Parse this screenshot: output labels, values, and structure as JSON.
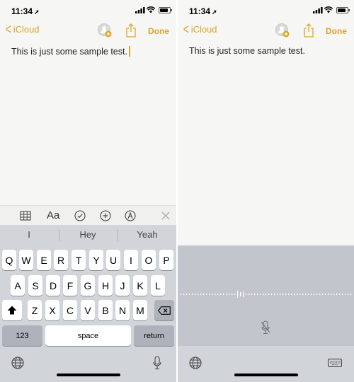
{
  "left": {
    "status": {
      "time": "11:34",
      "location_arrow": "➚"
    },
    "nav": {
      "back_label": "iCloud",
      "done_label": "Done"
    },
    "note_text": "This is just some sample test.",
    "format_toolbar": {
      "text_style": "Aa",
      "icons": [
        "table-icon",
        "checklist-icon",
        "plus-circle-icon",
        "markup-icon",
        "close-icon"
      ]
    },
    "predictions": [
      "I",
      "Hey",
      "Yeah"
    ],
    "keyboard": {
      "row1": [
        "Q",
        "W",
        "E",
        "R",
        "T",
        "Y",
        "U",
        "I",
        "O",
        "P"
      ],
      "row2": [
        "A",
        "S",
        "D",
        "F",
        "G",
        "H",
        "J",
        "K",
        "L"
      ],
      "row3": [
        "Z",
        "X",
        "C",
        "V",
        "B",
        "N",
        "M"
      ],
      "numbers_label": "123",
      "space_label": "space",
      "return_label": "return"
    }
  },
  "right": {
    "status": {
      "time": "11:34",
      "location_arrow": "➚"
    },
    "nav": {
      "back_label": "iCloud",
      "done_label": "Done"
    },
    "note_text": "This is just some sample test.",
    "dictation": {
      "state": "listening",
      "waveform": "dotted-line"
    }
  },
  "colors": {
    "accent": "#e0a425",
    "keyboard_bg": "#d1d4d9",
    "key_bg": "#ffffff",
    "dark_key_bg": "#adb2bb",
    "dictation_bg": "#c2c6cc"
  }
}
